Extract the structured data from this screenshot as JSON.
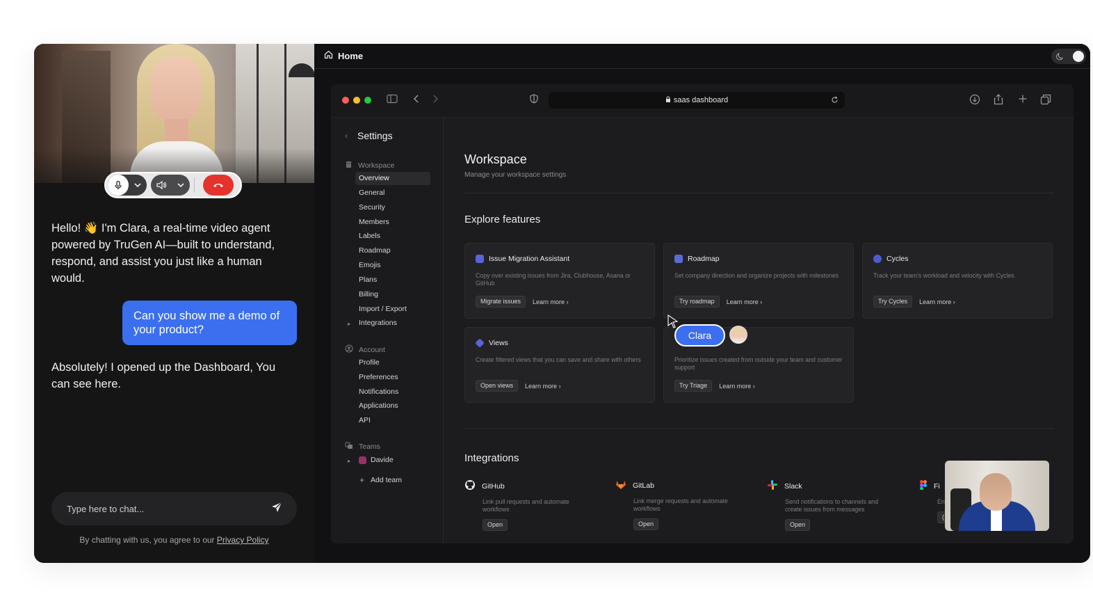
{
  "chat": {
    "messages": [
      {
        "role": "agent",
        "text": "Hello! 👋 I'm Clara, a real-time video agent powered by TruGen AI—built to understand, respond, and assist you just like a human would."
      },
      {
        "role": "user",
        "text": "Can you show me a demo of your product?"
      },
      {
        "role": "agent",
        "text": "Absolutely!  I opened up the Dashboard, You can see here."
      }
    ],
    "input_placeholder": "Type here to chat...",
    "disclaimer_prefix": "By chatting with us, you agree to our ",
    "privacy_link": "Privacy Policy",
    "end_call_color": "#e5322d",
    "user_bubble_color": "#3b6ff0"
  },
  "topbar": {
    "home_label": "Home",
    "theme": "dark"
  },
  "browser": {
    "url": "saas dashboard"
  },
  "sidebar": {
    "title": "Settings",
    "workspace_label": "Workspace",
    "workspace_items": [
      "Overview",
      "General",
      "Security",
      "Members",
      "Labels",
      "Roadmap",
      "Emojis",
      "Plans",
      "Billing",
      "Import / Export",
      "Integrations"
    ],
    "account_label": "Account",
    "account_items": [
      "Profile",
      "Preferences",
      "Notifications",
      "Applications",
      "API"
    ],
    "teams_label": "Teams",
    "team_name": "Davide",
    "add_team": "Add team"
  },
  "main": {
    "title": "Workspace",
    "subtitle": "Manage your workspace settings",
    "features_title": "Explore features",
    "features": [
      {
        "title": "Issue Migration Assistant",
        "desc": "Copy over existing issues from Jira, Clubhouse, Asana or GitHub",
        "button": "Migrate issues",
        "learn": "Learn more"
      },
      {
        "title": "Roadmap",
        "desc": "Set company direction and organize projects with milestones",
        "button": "Try roadmap",
        "learn": "Learn more"
      },
      {
        "title": "Cycles",
        "desc": "Track your team's workload and velocity with Cycles",
        "button": "Try Cycles",
        "learn": "Learn more"
      },
      {
        "title": "Views",
        "desc": "Create filtered views that you can save and share with others",
        "button": "Open views",
        "learn": "Learn more"
      },
      {
        "title": "",
        "desc": "Prioritize issues created from outside your team and customer support",
        "button": "Try Triage",
        "learn": "Learn more"
      }
    ],
    "integrations_title": "Integrations",
    "integrations": [
      {
        "name": "GitHub",
        "desc": "Link pull requests and automate workflows",
        "button": "Open"
      },
      {
        "name": "GitLab",
        "desc": "Link merge requests and automate workflows",
        "button": "Open"
      },
      {
        "name": "Slack",
        "desc": "Send notifications to channels and create issues from messages",
        "button": "Open"
      },
      {
        "name": "Fi",
        "desc": "En",
        "button": "("
      }
    ]
  },
  "overlay": {
    "agent_name": "Clara"
  }
}
